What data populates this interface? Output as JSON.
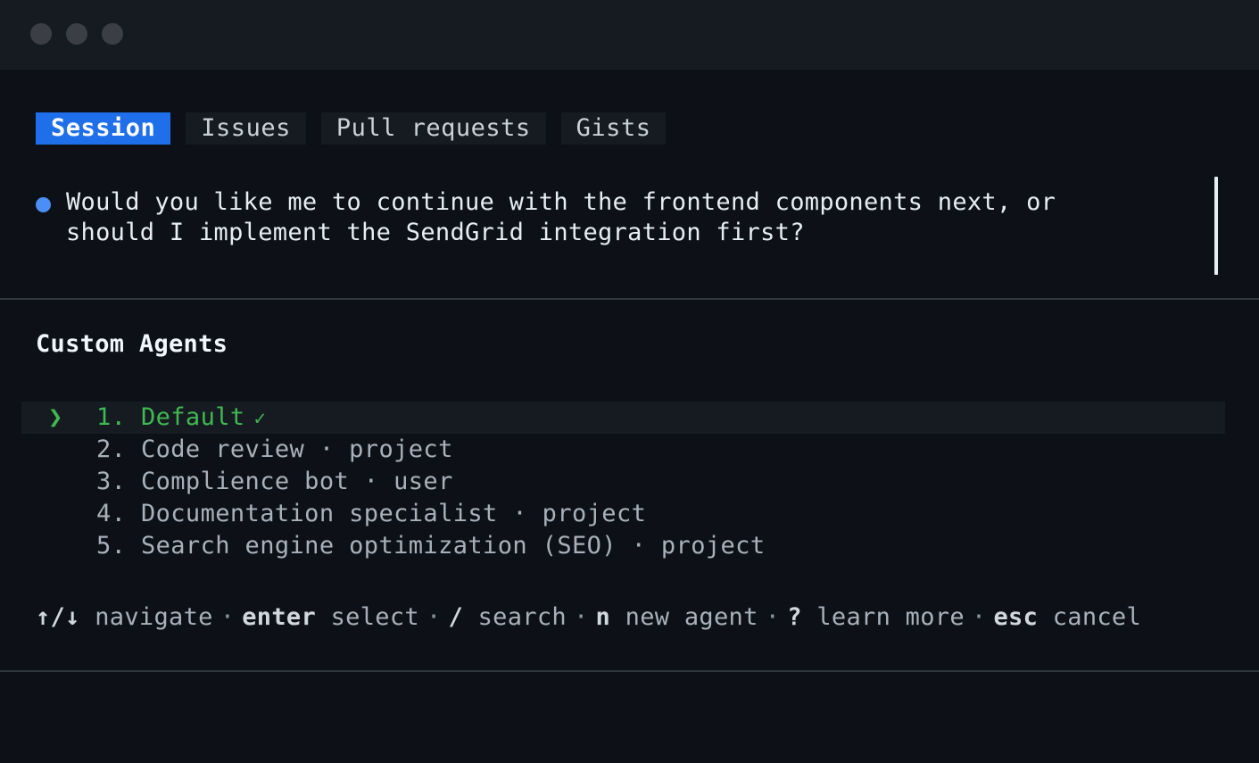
{
  "tabs": [
    {
      "label": "Session",
      "active": true
    },
    {
      "label": "Issues",
      "active": false
    },
    {
      "label": "Pull requests",
      "active": false
    },
    {
      "label": "Gists",
      "active": false
    }
  ],
  "message": {
    "text": "Would you like me to continue with the frontend components next, or\nshould I implement the SendGrid integration first?"
  },
  "agents": {
    "title": "Custom Agents",
    "selected_index": 0,
    "items": [
      {
        "label": "1. Default"
      },
      {
        "label": "2. Code review · project"
      },
      {
        "label": "3. Complience bot · user"
      },
      {
        "label": "4. Documentation specialist · project"
      },
      {
        "label": "5. Search engine optimization (SEO) · project"
      }
    ]
  },
  "help": {
    "navigate_key": "↑/↓",
    "navigate_label": "navigate",
    "enter_key": "enter",
    "enter_label": "select",
    "search_key": "/",
    "search_label": "search",
    "new_key": "n",
    "new_label": "new agent",
    "learn_key": "?",
    "learn_label": "learn more",
    "esc_key": "esc",
    "esc_label": "cancel",
    "separator": "·"
  },
  "icons": {
    "caret": "❯",
    "check": "✓"
  },
  "colors": {
    "accent": "#1f6feb",
    "success": "#3fb950",
    "bullet": "#4c8ef7",
    "background": "#0d1117"
  }
}
